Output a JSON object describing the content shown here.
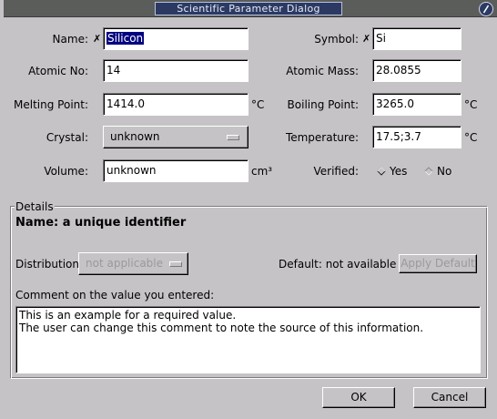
{
  "window": {
    "title": "Scientific Parameter Dialog"
  },
  "fields": {
    "name": {
      "label": "Name:",
      "value": "Silicon"
    },
    "symbol": {
      "label": "Symbol:",
      "value": "Si"
    },
    "atomic_no": {
      "label": "Atomic No:",
      "value": "14"
    },
    "atomic_mass": {
      "label": "Atomic Mass:",
      "value": "28.0855"
    },
    "melting_point": {
      "label": "Melting Point:",
      "value": "1414.0",
      "unit": "°C"
    },
    "boiling_point": {
      "label": "Boiling Point:",
      "value": "3265.0",
      "unit": "°C"
    },
    "crystal": {
      "label": "Crystal:",
      "value": "unknown"
    },
    "temperature": {
      "label": "Temperature:",
      "value": "17.5;3.7",
      "unit": "°C"
    },
    "volume": {
      "label": "Volume:",
      "value": "unknown",
      "unit": "cm³"
    },
    "verified": {
      "label": "Verified:",
      "yes": "Yes",
      "no": "No"
    }
  },
  "required_mark": "✗",
  "details": {
    "group_label": "Details",
    "heading": "Name: a unique identifier",
    "distribution_label": "Distribution:",
    "distribution_value": "not applicable",
    "default_text": "Default: not available",
    "apply_default": "Apply Default",
    "comment_label": "Comment on the value you entered:",
    "comment_lines": [
      "This is an example for a required value.",
      "The user can change this comment to note the source of this information."
    ]
  },
  "buttons": {
    "ok": "OK",
    "cancel": "Cancel"
  }
}
